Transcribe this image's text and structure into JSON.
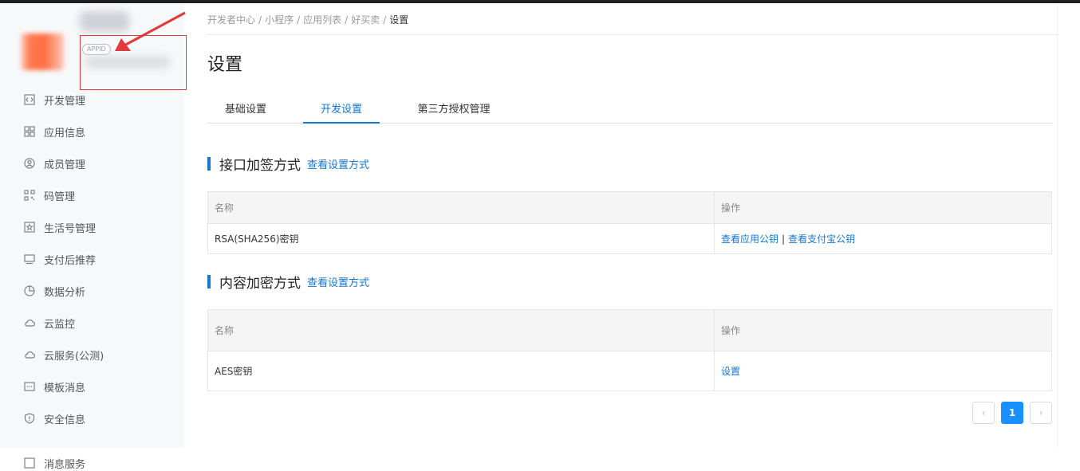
{
  "sidebar": {
    "app": {
      "appid_badge": "APPID"
    },
    "items": [
      {
        "label": "开发管理",
        "icon": "code-icon"
      },
      {
        "label": "应用信息",
        "icon": "grid-icon"
      },
      {
        "label": "成员管理",
        "icon": "user-icon"
      },
      {
        "label": "码管理",
        "icon": "qrcode-icon"
      },
      {
        "label": "生活号管理",
        "icon": "star-icon"
      },
      {
        "label": "支付后推荐",
        "icon": "monitor-icon"
      },
      {
        "label": "数据分析",
        "icon": "pie-icon"
      },
      {
        "label": "云监控",
        "icon": "cloud-icon"
      },
      {
        "label": "云服务(公测)",
        "icon": "cloud-icon"
      },
      {
        "label": "模板消息",
        "icon": "message-icon"
      },
      {
        "label": "安全信息",
        "icon": "shield-icon"
      },
      {
        "label": "消息服务",
        "icon": "bell-icon"
      }
    ]
  },
  "breadcrumb": [
    "开发者中心",
    "小程序",
    "应用列表",
    "好买卖",
    "设置"
  ],
  "page_title": "设置",
  "tabs": [
    {
      "label": "基础设置",
      "active": false
    },
    {
      "label": "开发设置",
      "active": true
    },
    {
      "label": "第三方授权管理",
      "active": false
    }
  ],
  "sections": [
    {
      "title": "接口加签方式",
      "link": "查看设置方式",
      "table": {
        "headers": [
          "名称",
          "操作"
        ],
        "rows": [
          {
            "name": "RSA(SHA256)密钥",
            "actions": [
              "查看应用公钥",
              "查看支付宝公钥"
            ]
          }
        ]
      }
    },
    {
      "title": "内容加密方式",
      "link": "查看设置方式",
      "table": {
        "headers": [
          "名称",
          "操作"
        ],
        "rows": [
          {
            "name": "AES密钥",
            "actions": [
              "设置"
            ]
          }
        ]
      }
    }
  ],
  "pagination": {
    "prev": "‹",
    "current": "1",
    "next": "›"
  },
  "colors": {
    "accent": "#1677d2",
    "annotation": "#e03a3a",
    "sidebar_bg": "#f7f8fa"
  }
}
